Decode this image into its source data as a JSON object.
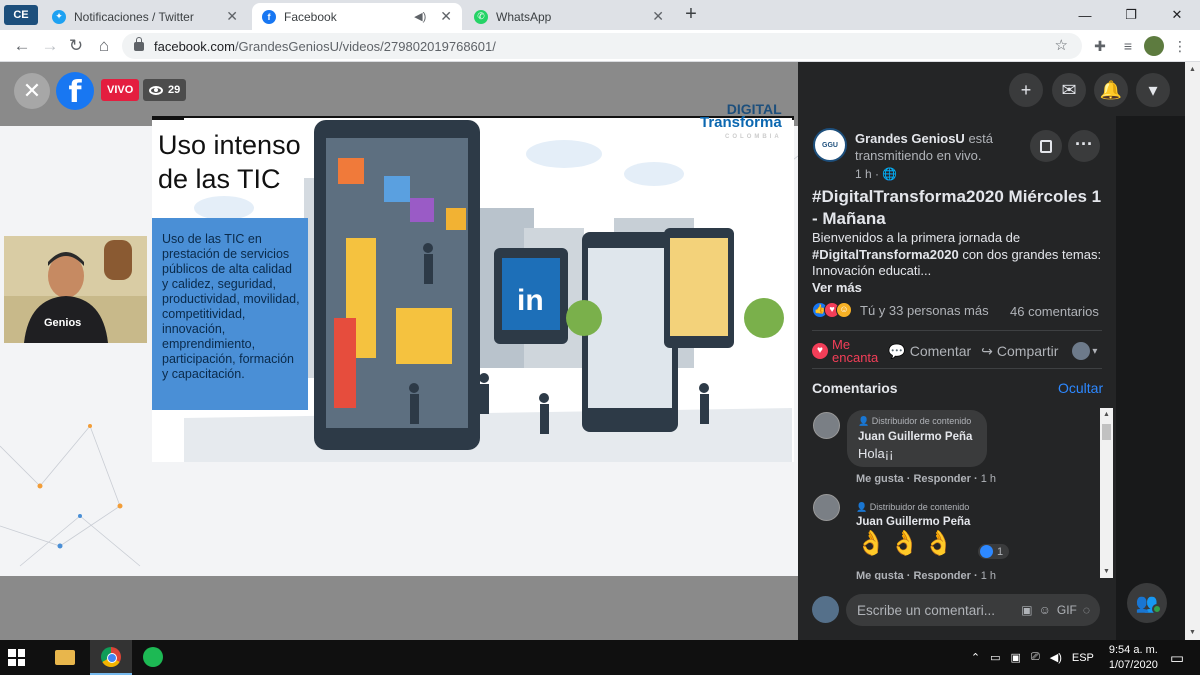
{
  "browser": {
    "ext_badge": "CE",
    "tabs": [
      {
        "title": "Notificaciones / Twitter",
        "icon": "twitter-icon",
        "active": false
      },
      {
        "title": "Facebook",
        "icon": "facebook-icon",
        "active": true
      },
      {
        "title": "WhatsApp",
        "icon": "whatsapp-icon",
        "active": false
      }
    ],
    "url_host": "facebook.com",
    "url_path": "/GrandesGeniosU/videos/279802019768601/"
  },
  "video": {
    "live_badge": "VIVO",
    "viewer_count": "29",
    "slide": {
      "title_line1": "Uso intenso",
      "title_line2": "de las TIC",
      "logo_line1": "DIGITAL",
      "logo_line2": "Transforma",
      "logo_line3": "COLOMBIA",
      "box_text": "Uso de las TIC en prestación de servicios públicos de alta calidad y calidez, seguridad, productividad, movilidad, competitividad, innovación, emprendimiento, participación, formación y capacitación."
    }
  },
  "post": {
    "page_name": "Grandes GeniosU",
    "status_text": "está transmitiendo en vivo.",
    "time": "1 h ·",
    "title": "#DigitalTransforma2020 Miércoles 1 - Mañana",
    "desc_part1": "Bienvenidos a la primera jornada de",
    "desc_hashtag": "#DigitalTransforma2020",
    "desc_part2": "con dos grandes temas: Innovación educati...",
    "see_more": "Ver más",
    "reactions_text": "Tú y 33 personas más",
    "comment_count": "46 comentarios",
    "actions": {
      "love_line1": "Me",
      "love_line2": "encanta",
      "comment": "Comentar",
      "share": "Compartir"
    }
  },
  "comments": {
    "header": "Comentarios",
    "hide": "Ocultar",
    "items": [
      {
        "role": "Distribuidor de contenido",
        "name": "Juan Guillermo Peña",
        "text": "Hola¡¡",
        "like": "Me gusta",
        "reply": "Responder",
        "time": "1 h"
      },
      {
        "role": "Distribuidor de contenido",
        "name": "Juan Guillermo Peña",
        "text": "👌👌👌",
        "like": "Me gusta",
        "reply": "Responder",
        "time": "1 h",
        "reaction_count": "1"
      }
    ],
    "composer_placeholder": "Escribe un comentari..."
  },
  "taskbar": {
    "language": "ESP",
    "time": "9:54 a. m.",
    "date": "1/07/2020"
  },
  "colors": {
    "facebook_blue": "#1877f2",
    "live_red": "#e41e3f",
    "panel_bg": "#242526",
    "link_blue": "#2d88ff"
  }
}
